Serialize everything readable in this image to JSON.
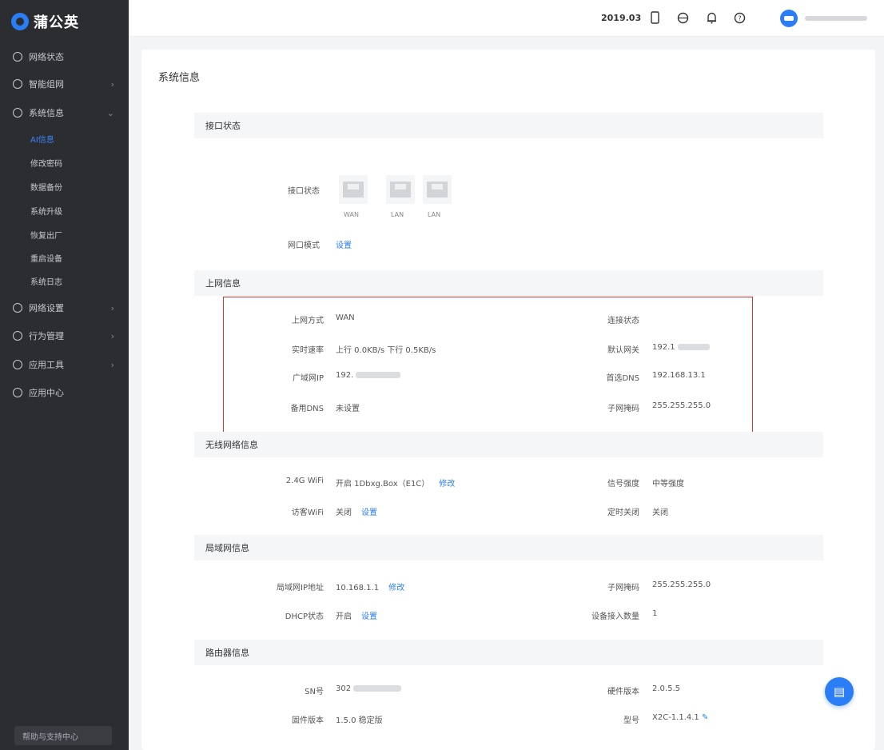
{
  "sidebar": {
    "logo": "蒲公英",
    "nav": [
      {
        "label": "网络状态",
        "icon": "globe-icon",
        "expandable": false
      },
      {
        "label": "智能组网",
        "icon": "network-icon",
        "expandable": true
      },
      {
        "label": "系统信息",
        "icon": "settings-icon",
        "expandable": true,
        "expanded": true
      },
      {
        "label": "网络设置",
        "icon": "grid-icon",
        "expandable": true
      },
      {
        "label": "行为管理",
        "icon": "shield-icon",
        "expandable": true
      },
      {
        "label": "应用工具",
        "icon": "tools-icon",
        "expandable": true
      },
      {
        "label": "应用中心",
        "icon": "apps-icon",
        "expandable": false
      }
    ],
    "subitems": [
      {
        "label": "AI信息",
        "active": true
      },
      {
        "label": "修改密码",
        "active": false
      },
      {
        "label": "数据备份",
        "active": false
      },
      {
        "label": "系统升级",
        "active": false
      },
      {
        "label": "恢复出厂",
        "active": false
      },
      {
        "label": "重启设备",
        "active": false
      },
      {
        "label": "系统日志",
        "active": false
      }
    ],
    "help_label": "帮助与支持中心"
  },
  "topbar": {
    "text": "2019.03",
    "icons": [
      "phone-icon",
      "globe-icon",
      "bell-icon",
      "help-icon"
    ]
  },
  "page": {
    "title": "系统信息"
  },
  "sections": {
    "port_status": {
      "title": "接口状态",
      "port_label": "接口状态",
      "ports": [
        "WAN",
        "LAN",
        "LAN"
      ],
      "mode_label": "网口模式",
      "mode_value": "设置"
    },
    "uplink": {
      "title": "上网信息",
      "rows": [
        {
          "l_label": "上网方式",
          "l_value": "WAN",
          "r_label": "连接状态",
          "r_value": ""
        },
        {
          "l_label": "实时速率",
          "l_value": "上行 0.0KB/s    下行 0.5KB/s",
          "r_label": "默认网关",
          "r_value": "192.1"
        },
        {
          "l_label": "广域网IP",
          "l_value": "192.",
          "r_label": "首选DNS",
          "r_value": "192.168.13.1"
        },
        {
          "l_label": "备用DNS",
          "l_value": "未设置",
          "r_label": "子网掩码",
          "r_value": "255.255.255.0"
        }
      ]
    },
    "wireless": {
      "title": "无线网络信息",
      "rows": [
        {
          "l_label": "2.4G WiFi",
          "l_value": "开启  1Dbxg.Box（E1C）",
          "l_link": "修改",
          "r_label": "信号强度",
          "r_value": "中等强度"
        },
        {
          "l_label": "访客WiFi",
          "l_value": "关闭",
          "l_link": "设置",
          "r_label": "定时关闭",
          "r_value": "关闭"
        }
      ]
    },
    "lan": {
      "title": "局域网信息",
      "rows": [
        {
          "l_label": "局域网IP地址",
          "l_value": "10.168.1.1",
          "l_link": "修改",
          "r_label": "子网掩码",
          "r_value": "255.255.255.0"
        },
        {
          "l_label": "DHCP状态",
          "l_value": "开启",
          "l_link": "设置",
          "r_label": "设备接入数量",
          "r_value": "1"
        }
      ]
    },
    "router": {
      "title": "路由器信息",
      "rows": [
        {
          "l_label": "SN号",
          "l_value": "302",
          "r_label": "硬件版本",
          "r_value": "2.0.5.5"
        },
        {
          "l_label": "固件版本",
          "l_value": "1.5.0 稳定版",
          "r_label": "型号",
          "r_value": "X2C-1.1.4.1"
        }
      ]
    }
  },
  "float_button": {
    "icon": "document-icon"
  },
  "colors": {
    "accent": "#2a7df4",
    "sidebar_bg": "#2b2d31",
    "highlight": "#e0302a"
  }
}
